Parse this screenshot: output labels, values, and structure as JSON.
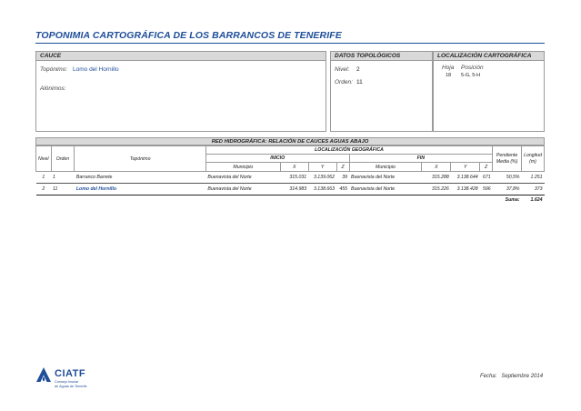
{
  "title": "TOPONIMIA CARTOGRÁFICA DE LOS BARRANCOS DE TENERIFE",
  "cauce": {
    "header": "CAUCE",
    "toponimo_label": "Topónimo:",
    "toponimo_value": "Lomo del Hornillo",
    "alonimos_label": "Alónimos:"
  },
  "datos": {
    "header": "DATOS TOPOLÓGICOS",
    "nivel_label": "Nivel:",
    "nivel_value": "2",
    "orden_label": "Orden:",
    "orden_value": "11"
  },
  "localizacion": {
    "header": "LOCALIZACIÓN CARTOGRÁFICA",
    "hoja_label": "Hoja",
    "posicion_label": "Posición",
    "hoja_value": "18",
    "posicion_value": "5-G, 5-H"
  },
  "red": {
    "header": "RED HIDROGRÁFICA: RELACIÓN DE CAUCES AGUAS ABAJO",
    "col_nivel": "Nivel",
    "col_orden": "Orden",
    "col_toponimo": "Topónimo",
    "col_loc_geo": "LOCALIZACIÓN GEOGRÁFICA",
    "col_inicio": "INICIO",
    "col_fin": "FIN",
    "col_municipio": "Municipio",
    "col_x": "X",
    "col_y": "Y",
    "col_z": "Z",
    "col_pendiente_1": "Pendiente",
    "col_pendiente_2": "Media (%)",
    "col_longitud_1": "Longitud",
    "col_longitud_2": "(m)",
    "rows": [
      {
        "nivel": "1",
        "orden": "1",
        "toponimo": "Barranco Barrete",
        "ini_mun": "Buenavista del Norte",
        "ini_x": "315.031",
        "ini_y": "3.139.062",
        "ini_z": "39",
        "fin_mun": "Buenavista del Norte",
        "fin_x": "315.288",
        "fin_y": "3.138.644",
        "fin_z": "671",
        "pendiente": "50,5%",
        "longitud": "1.251"
      },
      {
        "nivel": "2",
        "orden": "11",
        "toponimo": "Lomo del Hornillo",
        "ini_mun": "Buenavista del Norte",
        "ini_x": "314.983",
        "ini_y": "3.138.663",
        "ini_z": "455",
        "fin_mun": "Buenavista del Norte",
        "fin_x": "315.226",
        "fin_y": "3.138.428",
        "fin_z": "596",
        "pendiente": "37,8%",
        "longitud": "373"
      }
    ],
    "suma_label": "Suma:",
    "suma_value": "1.624"
  },
  "footer": {
    "logo": "CIATF",
    "logo_sub1": "Consejo Insular",
    "logo_sub2": "de Aguas de Tenerife",
    "fecha_label": "Fecha:",
    "fecha_value": "Septiembre  2014"
  },
  "colors": {
    "accent": "#1f4e9a",
    "header_bg": "#d9d9d9",
    "border": "#9a9a9a"
  }
}
